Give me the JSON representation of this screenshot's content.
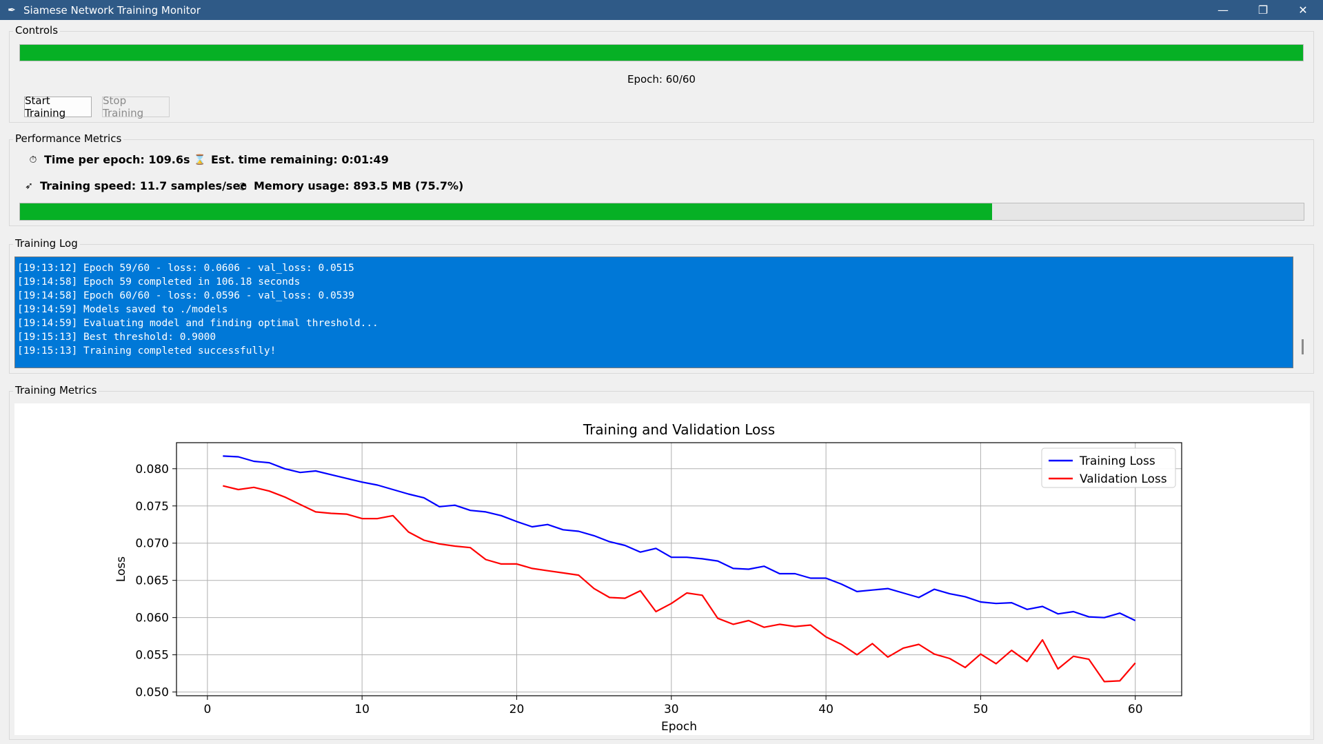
{
  "window": {
    "title": "Siamese Network Training Monitor",
    "icon": "feather-icon",
    "minimize": "—",
    "restore": "❐",
    "close": "✕"
  },
  "controls": {
    "label": "Controls",
    "progress_fraction": 1.0,
    "epoch_text": "Epoch: 60/60",
    "start_label": "Start Training",
    "stop_label": "Stop Training"
  },
  "performance": {
    "label": "Performance Metrics",
    "time_per_epoch": "Time per epoch: 109.6s",
    "est_remaining": "Est. time remaining: 0:01:49",
    "training_speed": "Training speed: 11.7 samples/sec",
    "memory_usage": "Memory usage: 893.5 MB (75.7%)",
    "memory_fraction": 0.757,
    "icons": {
      "time": "stopwatch-icon",
      "remaining": "hourglass-icon",
      "speed": "rocket-icon",
      "memory": "gauge-icon"
    }
  },
  "log": {
    "label": "Training Log",
    "lines": [
      "[19:13:12] Epoch 59/60 - loss: 0.0606 - val_loss: 0.0515",
      "[19:14:58] Epoch 59 completed in 106.18 seconds",
      "[19:14:58] Epoch 60/60 - loss: 0.0596 - val_loss: 0.0539",
      "[19:14:59] Models saved to ./models",
      "[19:14:59] Evaluating model and finding optimal threshold...",
      "[19:15:13] Best threshold: 0.9000",
      "[19:15:13] Training completed successfully!"
    ]
  },
  "metrics_section": {
    "label": "Training Metrics"
  },
  "colors": {
    "progress_green": "#06b025",
    "log_bg": "#0078d7",
    "titlebar": "#2f5a87",
    "training_series": "#0000ff",
    "validation_series": "#ff0000"
  },
  "chart_data": {
    "type": "line",
    "title": "Training and Validation Loss",
    "xlabel": "Epoch",
    "ylabel": "Loss",
    "xlim": [
      -2,
      63
    ],
    "ylim": [
      0.0495,
      0.0835
    ],
    "xticks": [
      0,
      10,
      20,
      30,
      40,
      50,
      60
    ],
    "yticks": [
      0.05,
      0.055,
      0.06,
      0.065,
      0.07,
      0.075,
      0.08
    ],
    "grid": true,
    "legend_position": "top-right",
    "x": [
      1,
      2,
      3,
      4,
      5,
      6,
      7,
      8,
      9,
      10,
      11,
      12,
      13,
      14,
      15,
      16,
      17,
      18,
      19,
      20,
      21,
      22,
      23,
      24,
      25,
      26,
      27,
      28,
      29,
      30,
      31,
      32,
      33,
      34,
      35,
      36,
      37,
      38,
      39,
      40,
      41,
      42,
      43,
      44,
      45,
      46,
      47,
      48,
      49,
      50,
      51,
      52,
      53,
      54,
      55,
      56,
      57,
      58,
      59,
      60
    ],
    "series": [
      {
        "name": "Training Loss",
        "color": "#0000ff",
        "values": [
          0.0817,
          0.0816,
          0.081,
          0.0808,
          0.08,
          0.0795,
          0.0797,
          0.0792,
          0.0787,
          0.0782,
          0.0778,
          0.0772,
          0.0766,
          0.0761,
          0.0749,
          0.0751,
          0.0744,
          0.0742,
          0.0737,
          0.0729,
          0.0722,
          0.0725,
          0.0718,
          0.0716,
          0.071,
          0.0702,
          0.0697,
          0.0688,
          0.0693,
          0.0681,
          0.0681,
          0.0679,
          0.0676,
          0.0666,
          0.0665,
          0.0669,
          0.0659,
          0.0659,
          0.0653,
          0.0653,
          0.0645,
          0.0635,
          0.0637,
          0.0639,
          0.0633,
          0.0627,
          0.0638,
          0.0632,
          0.0628,
          0.0621,
          0.0619,
          0.062,
          0.0611,
          0.0615,
          0.0605,
          0.0608,
          0.0601,
          0.06,
          0.0606,
          0.0596
        ]
      },
      {
        "name": "Validation Loss",
        "color": "#ff0000",
        "values": [
          0.0777,
          0.0772,
          0.0775,
          0.077,
          0.0762,
          0.0752,
          0.0742,
          0.074,
          0.0739,
          0.0733,
          0.0733,
          0.0737,
          0.0715,
          0.0704,
          0.0699,
          0.0696,
          0.0694,
          0.0678,
          0.0672,
          0.0672,
          0.0666,
          0.0663,
          0.066,
          0.0657,
          0.0639,
          0.0627,
          0.0626,
          0.0636,
          0.0608,
          0.0619,
          0.0633,
          0.063,
          0.0599,
          0.0591,
          0.0596,
          0.0587,
          0.0591,
          0.0588,
          0.059,
          0.0574,
          0.0564,
          0.055,
          0.0565,
          0.0547,
          0.0559,
          0.0564,
          0.0551,
          0.0545,
          0.0533,
          0.0551,
          0.0538,
          0.0556,
          0.0541,
          0.057,
          0.0531,
          0.0548,
          0.0544,
          0.0514,
          0.0515,
          0.0539
        ]
      }
    ]
  }
}
